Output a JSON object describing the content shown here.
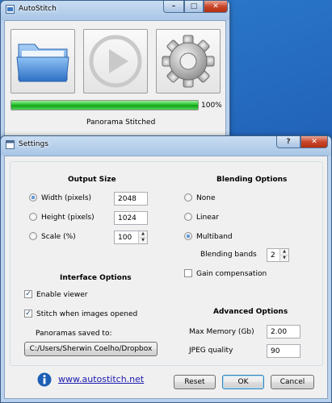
{
  "main_window": {
    "title": "AutoStitch",
    "buttons": {
      "open_icon": "folder-icon",
      "stitch_icon": "play-icon",
      "settings_icon": "gear-icon"
    },
    "progress_percent": 100,
    "progress_label": "100%",
    "status": "Panorama Stitched",
    "controls": {
      "minimize": "–",
      "maximize": "□",
      "close": "✕"
    }
  },
  "settings": {
    "title": "Settings",
    "controls": {
      "help": "?",
      "close": "✕"
    },
    "output_size": {
      "heading": "Output Size",
      "width_label": "Width (pixels)",
      "width_value": "2048",
      "height_label": "Height (pixels)",
      "height_value": "1024",
      "scale_label": "Scale (%)",
      "scale_value": "100",
      "selected": "width"
    },
    "blending": {
      "heading": "Blending Options",
      "none_label": "None",
      "linear_label": "Linear",
      "multiband_label": "Multiband",
      "selected": "multiband",
      "bands_label": "Blending bands",
      "bands_value": "2",
      "gain_label": "Gain compensation",
      "gain_checked": false
    },
    "interface": {
      "heading": "Interface Options",
      "enable_viewer_label": "Enable viewer",
      "enable_viewer_checked": true,
      "stitch_opened_label": "Stitch when images opened",
      "stitch_opened_checked": true,
      "saved_to_label": "Panoramas saved to:",
      "saved_to_path": "C:/Users/Sherwin Coelho/Dropbox"
    },
    "advanced": {
      "heading": "Advanced Options",
      "max_memory_label": "Max Memory (Gb)",
      "max_memory_value": "2.00",
      "jpeg_label": "JPEG quality",
      "jpeg_value": "90"
    },
    "link": "www.autostitch.net",
    "info_icon": "info-icon",
    "buttons": {
      "reset": "Reset",
      "ok": "OK",
      "cancel": "Cancel"
    }
  },
  "colors": {
    "progress": "#14a11a",
    "link": "#1a1ab0",
    "info_icon": "#1d5fb6"
  }
}
